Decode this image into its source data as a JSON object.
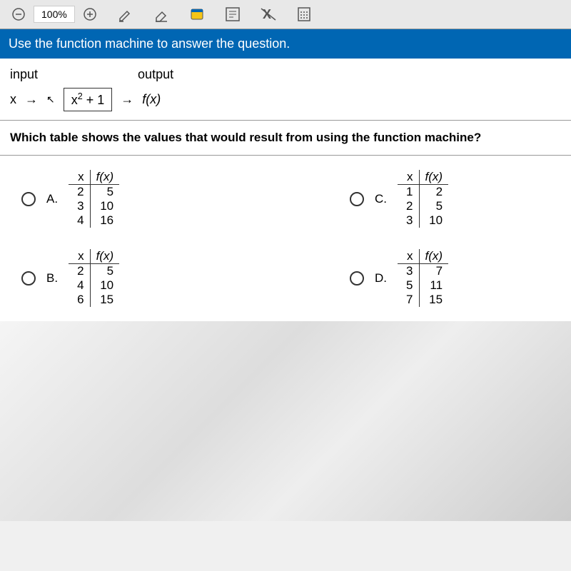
{
  "toolbar": {
    "zoom_value": "100%"
  },
  "instruction": "Use the function machine to answer the question.",
  "machine": {
    "input_label": "input",
    "output_label": "output",
    "x": "x",
    "arrow": "→",
    "rule_base": "x",
    "rule_exp": "2",
    "rule_rest": " + 1",
    "fx": "f(x)"
  },
  "question": "Which table shows the values that would result from using the function machine?",
  "choices": {
    "a": {
      "label": "A.",
      "header_x": "x",
      "header_fx": "f(x)",
      "rows": [
        [
          "2",
          "5"
        ],
        [
          "3",
          "10"
        ],
        [
          "4",
          "16"
        ]
      ]
    },
    "b": {
      "label": "B.",
      "header_x": "x",
      "header_fx": "f(x)",
      "rows": [
        [
          "2",
          "5"
        ],
        [
          "4",
          "10"
        ],
        [
          "6",
          "15"
        ]
      ]
    },
    "c": {
      "label": "C.",
      "header_x": "x",
      "header_fx": "f(x)",
      "rows": [
        [
          "1",
          "2"
        ],
        [
          "2",
          "5"
        ],
        [
          "3",
          "10"
        ]
      ]
    },
    "d": {
      "label": "D.",
      "header_x": "x",
      "header_fx": "f(x)",
      "rows": [
        [
          "3",
          "7"
        ],
        [
          "5",
          "11"
        ],
        [
          "7",
          "15"
        ]
      ]
    }
  }
}
